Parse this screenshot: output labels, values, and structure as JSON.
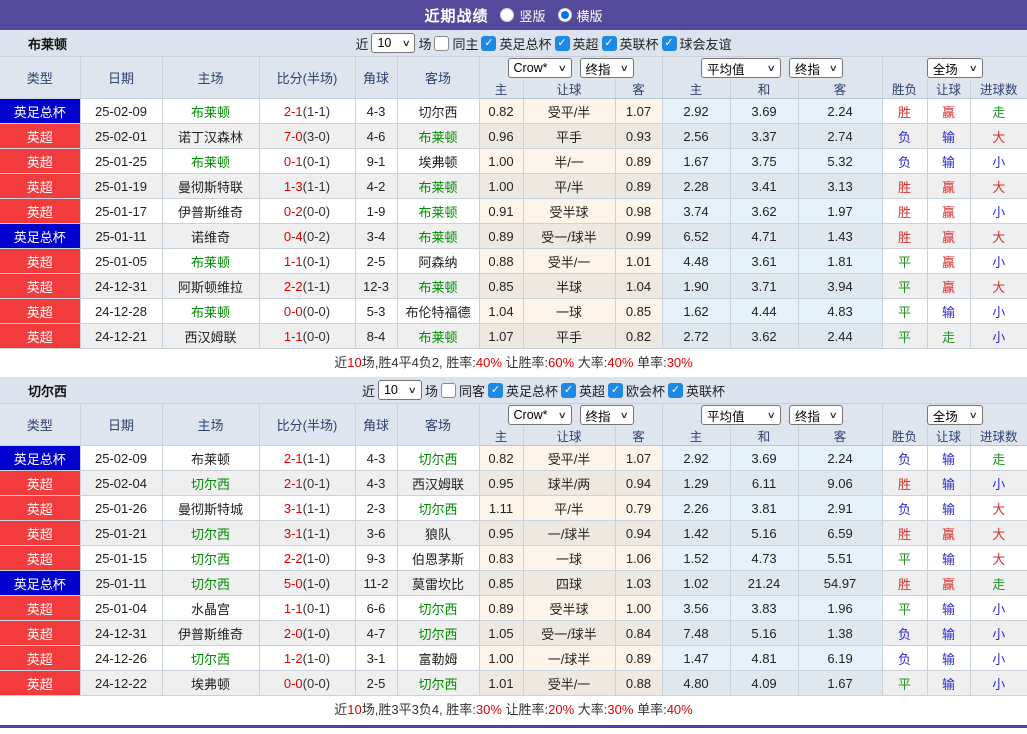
{
  "header": {
    "title": "近期战绩",
    "radios": [
      {
        "label": "竖版",
        "checked": false
      },
      {
        "label": "横版",
        "checked": true
      }
    ]
  },
  "icons": {
    "dropdown": "∨",
    "check": "✓"
  },
  "colors": {
    "titlebar": "#54499B",
    "cup_badge": "#0101CD",
    "league_badge": "#F23B3C",
    "team_green": "#008C00",
    "score_red": "#E10000",
    "result_red": "#D93030",
    "result_blue": "#2A2ACF",
    "result_green": "#1F9426"
  },
  "columns": {
    "main": [
      "类型",
      "日期",
      "主场",
      "比分(半场)",
      "角球",
      "客场"
    ],
    "sub": [
      "主",
      "让球",
      "客",
      "主",
      "和",
      "客",
      "胜负",
      "让球",
      "进球数"
    ],
    "selects": {
      "crow": "Crow*",
      "zhong1": "终指",
      "avg": "平均值",
      "zhong2": "终指",
      "full": "全场"
    }
  },
  "sections": [
    {
      "team": "布莱顿",
      "filter": {
        "prefix": "近",
        "count": "10",
        "suffix": "场",
        "same": "同主",
        "leagues": [
          "英足总杯",
          "英超",
          "英联杯",
          "球会友谊"
        ]
      },
      "rows": [
        {
          "type": "英足总杯",
          "type_c": "cup",
          "date": "25-02-09",
          "home": "布莱顿",
          "home_g": true,
          "score": "2-1",
          "half": "(1-1)",
          "corner": "4-3",
          "away": "切尔西",
          "away_g": false,
          "o1": "0.82",
          "hcap": "受平/半",
          "o2": "1.07",
          "a1": "2.92",
          "a2": "3.69",
          "a3": "2.24",
          "wl": "胜",
          "wl_c": "r",
          "hd": "赢",
          "hd_c": "r",
          "ou": "走",
          "ou_c": "g"
        },
        {
          "type": "英超",
          "type_c": "league",
          "date": "25-02-01",
          "home": "诺丁汉森林",
          "home_g": false,
          "score": "7-0",
          "half": "(3-0)",
          "corner": "4-6",
          "away": "布莱顿",
          "away_g": true,
          "o1": "0.96",
          "hcap": "平手",
          "o2": "0.93",
          "a1": "2.56",
          "a2": "3.37",
          "a3": "2.74",
          "wl": "负",
          "wl_c": "b",
          "hd": "输",
          "hd_c": "b",
          "ou": "大",
          "ou_c": "r"
        },
        {
          "type": "英超",
          "type_c": "league",
          "date": "25-01-25",
          "home": "布莱顿",
          "home_g": true,
          "score": "0-1",
          "half": "(0-1)",
          "corner": "9-1",
          "away": "埃弗顿",
          "away_g": false,
          "o1": "1.00",
          "hcap": "半/一",
          "o2": "0.89",
          "a1": "1.67",
          "a2": "3.75",
          "a3": "5.32",
          "wl": "负",
          "wl_c": "b",
          "hd": "输",
          "hd_c": "b",
          "ou": "小",
          "ou_c": "b"
        },
        {
          "type": "英超",
          "type_c": "league",
          "date": "25-01-19",
          "home": "曼彻斯特联",
          "home_g": false,
          "score": "1-3",
          "half": "(1-1)",
          "corner": "4-2",
          "away": "布莱顿",
          "away_g": true,
          "o1": "1.00",
          "hcap": "平/半",
          "o2": "0.89",
          "a1": "2.28",
          "a2": "3.41",
          "a3": "3.13",
          "wl": "胜",
          "wl_c": "r",
          "hd": "赢",
          "hd_c": "r",
          "ou": "大",
          "ou_c": "r"
        },
        {
          "type": "英超",
          "type_c": "league",
          "date": "25-01-17",
          "home": "伊普斯维奇",
          "home_g": false,
          "score": "0-2",
          "half": "(0-0)",
          "corner": "1-9",
          "away": "布莱顿",
          "away_g": true,
          "o1": "0.91",
          "hcap": "受半球",
          "o2": "0.98",
          "a1": "3.74",
          "a2": "3.62",
          "a3": "1.97",
          "wl": "胜",
          "wl_c": "r",
          "hd": "赢",
          "hd_c": "r",
          "ou": "小",
          "ou_c": "b"
        },
        {
          "type": "英足总杯",
          "type_c": "cup",
          "date": "25-01-11",
          "home": "诺维奇",
          "home_g": false,
          "score": "0-4",
          "half": "(0-2)",
          "corner": "3-4",
          "away": "布莱顿",
          "away_g": true,
          "o1": "0.89",
          "hcap": "受一/球半",
          "o2": "0.99",
          "a1": "6.52",
          "a2": "4.71",
          "a3": "1.43",
          "wl": "胜",
          "wl_c": "r",
          "hd": "赢",
          "hd_c": "r",
          "ou": "大",
          "ou_c": "r"
        },
        {
          "type": "英超",
          "type_c": "league",
          "date": "25-01-05",
          "home": "布莱顿",
          "home_g": true,
          "score": "1-1",
          "half": "(0-1)",
          "corner": "2-5",
          "away": "阿森纳",
          "away_g": false,
          "o1": "0.88",
          "hcap": "受半/一",
          "o2": "1.01",
          "a1": "4.48",
          "a2": "3.61",
          "a3": "1.81",
          "wl": "平",
          "wl_c": "g",
          "hd": "赢",
          "hd_c": "r",
          "ou": "小",
          "ou_c": "b"
        },
        {
          "type": "英超",
          "type_c": "league",
          "date": "24-12-31",
          "home": "阿斯顿维拉",
          "home_g": false,
          "score": "2-2",
          "half": "(1-1)",
          "corner": "12-3",
          "away": "布莱顿",
          "away_g": true,
          "o1": "0.85",
          "hcap": "半球",
          "o2": "1.04",
          "a1": "1.90",
          "a2": "3.71",
          "a3": "3.94",
          "wl": "平",
          "wl_c": "g",
          "hd": "赢",
          "hd_c": "r",
          "ou": "大",
          "ou_c": "r"
        },
        {
          "type": "英超",
          "type_c": "league",
          "date": "24-12-28",
          "home": "布莱顿",
          "home_g": true,
          "score": "0-0",
          "half": "(0-0)",
          "corner": "5-3",
          "away": "布伦特福德",
          "away_g": false,
          "o1": "1.04",
          "hcap": "一球",
          "o2": "0.85",
          "a1": "1.62",
          "a2": "4.44",
          "a3": "4.83",
          "wl": "平",
          "wl_c": "g",
          "hd": "输",
          "hd_c": "b",
          "ou": "小",
          "ou_c": "b"
        },
        {
          "type": "英超",
          "type_c": "league",
          "date": "24-12-21",
          "home": "西汉姆联",
          "home_g": false,
          "score": "1-1",
          "half": "(0-0)",
          "corner": "8-4",
          "away": "布莱顿",
          "away_g": true,
          "o1": "1.07",
          "hcap": "平手",
          "o2": "0.82",
          "a1": "2.72",
          "a2": "3.62",
          "a3": "2.44",
          "wl": "平",
          "wl_c": "g",
          "hd": "走",
          "hd_c": "g",
          "ou": "小",
          "ou_c": "b"
        }
      ],
      "summary": [
        {
          "text": "近",
          "red": false
        },
        {
          "text": "10",
          "red": true
        },
        {
          "text": "场,胜4平4负2, 胜率:",
          "red": false
        },
        {
          "text": "40%",
          "red": true
        },
        {
          "text": " 让胜率:",
          "red": false
        },
        {
          "text": "60%",
          "red": true
        },
        {
          "text": " 大率:",
          "red": false
        },
        {
          "text": "40%",
          "red": true
        },
        {
          "text": " 单率:",
          "red": false
        },
        {
          "text": "30%",
          "red": true
        }
      ]
    },
    {
      "team": "切尔西",
      "filter": {
        "prefix": "近",
        "count": "10",
        "suffix": "场",
        "same": "同客",
        "leagues": [
          "英足总杯",
          "英超",
          "欧会杯",
          "英联杯"
        ]
      },
      "rows": [
        {
          "type": "英足总杯",
          "type_c": "cup",
          "date": "25-02-09",
          "home": "布莱顿",
          "home_g": false,
          "score": "2-1",
          "half": "(1-1)",
          "corner": "4-3",
          "away": "切尔西",
          "away_g": true,
          "o1": "0.82",
          "hcap": "受平/半",
          "o2": "1.07",
          "a1": "2.92",
          "a2": "3.69",
          "a3": "2.24",
          "wl": "负",
          "wl_c": "b",
          "hd": "输",
          "hd_c": "b",
          "ou": "走",
          "ou_c": "g"
        },
        {
          "type": "英超",
          "type_c": "league",
          "date": "25-02-04",
          "home": "切尔西",
          "home_g": true,
          "score": "2-1",
          "half": "(0-1)",
          "corner": "4-3",
          "away": "西汉姆联",
          "away_g": false,
          "o1": "0.95",
          "hcap": "球半/两",
          "o2": "0.94",
          "a1": "1.29",
          "a2": "6.11",
          "a3": "9.06",
          "wl": "胜",
          "wl_c": "r",
          "hd": "输",
          "hd_c": "b",
          "ou": "小",
          "ou_c": "b"
        },
        {
          "type": "英超",
          "type_c": "league",
          "date": "25-01-26",
          "home": "曼彻斯特城",
          "home_g": false,
          "score": "3-1",
          "half": "(1-1)",
          "corner": "2-3",
          "away": "切尔西",
          "away_g": true,
          "o1": "1.11",
          "hcap": "平/半",
          "o2": "0.79",
          "a1": "2.26",
          "a2": "3.81",
          "a3": "2.91",
          "wl": "负",
          "wl_c": "b",
          "hd": "输",
          "hd_c": "b",
          "ou": "大",
          "ou_c": "r"
        },
        {
          "type": "英超",
          "type_c": "league",
          "date": "25-01-21",
          "home": "切尔西",
          "home_g": true,
          "score": "3-1",
          "half": "(1-1)",
          "corner": "3-6",
          "away": "狼队",
          "away_g": false,
          "o1": "0.95",
          "hcap": "一/球半",
          "o2": "0.94",
          "a1": "1.42",
          "a2": "5.16",
          "a3": "6.59",
          "wl": "胜",
          "wl_c": "r",
          "hd": "赢",
          "hd_c": "r",
          "ou": "大",
          "ou_c": "r"
        },
        {
          "type": "英超",
          "type_c": "league",
          "date": "25-01-15",
          "home": "切尔西",
          "home_g": true,
          "score": "2-2",
          "half": "(1-0)",
          "corner": "9-3",
          "away": "伯恩茅斯",
          "away_g": false,
          "o1": "0.83",
          "hcap": "一球",
          "o2": "1.06",
          "a1": "1.52",
          "a2": "4.73",
          "a3": "5.51",
          "wl": "平",
          "wl_c": "g",
          "hd": "输",
          "hd_c": "b",
          "ou": "大",
          "ou_c": "r"
        },
        {
          "type": "英足总杯",
          "type_c": "cup",
          "date": "25-01-11",
          "home": "切尔西",
          "home_g": true,
          "score": "5-0",
          "half": "(1-0)",
          "corner": "11-2",
          "away": "莫雷坎比",
          "away_g": false,
          "o1": "0.85",
          "hcap": "四球",
          "o2": "1.03",
          "a1": "1.02",
          "a2": "21.24",
          "a3": "54.97",
          "wl": "胜",
          "wl_c": "r",
          "hd": "赢",
          "hd_c": "r",
          "ou": "走",
          "ou_c": "g"
        },
        {
          "type": "英超",
          "type_c": "league",
          "date": "25-01-04",
          "home": "水晶宫",
          "home_g": false,
          "score": "1-1",
          "half": "(0-1)",
          "corner": "6-6",
          "away": "切尔西",
          "away_g": true,
          "o1": "0.89",
          "hcap": "受半球",
          "o2": "1.00",
          "a1": "3.56",
          "a2": "3.83",
          "a3": "1.96",
          "wl": "平",
          "wl_c": "g",
          "hd": "输",
          "hd_c": "b",
          "ou": "小",
          "ou_c": "b"
        },
        {
          "type": "英超",
          "type_c": "league",
          "date": "24-12-31",
          "home": "伊普斯维奇",
          "home_g": false,
          "score": "2-0",
          "half": "(1-0)",
          "corner": "4-7",
          "away": "切尔西",
          "away_g": true,
          "o1": "1.05",
          "hcap": "受一/球半",
          "o2": "0.84",
          "a1": "7.48",
          "a2": "5.16",
          "a3": "1.38",
          "wl": "负",
          "wl_c": "b",
          "hd": "输",
          "hd_c": "b",
          "ou": "小",
          "ou_c": "b"
        },
        {
          "type": "英超",
          "type_c": "league",
          "date": "24-12-26",
          "home": "切尔西",
          "home_g": true,
          "score": "1-2",
          "half": "(1-0)",
          "corner": "3-1",
          "away": "富勒姆",
          "away_g": false,
          "o1": "1.00",
          "hcap": "一/球半",
          "o2": "0.89",
          "a1": "1.47",
          "a2": "4.81",
          "a3": "6.19",
          "wl": "负",
          "wl_c": "b",
          "hd": "输",
          "hd_c": "b",
          "ou": "小",
          "ou_c": "b"
        },
        {
          "type": "英超",
          "type_c": "league",
          "date": "24-12-22",
          "home": "埃弗顿",
          "home_g": false,
          "score": "0-0",
          "half": "(0-0)",
          "corner": "2-5",
          "away": "切尔西",
          "away_g": true,
          "o1": "1.01",
          "hcap": "受半/一",
          "o2": "0.88",
          "a1": "4.80",
          "a2": "4.09",
          "a3": "1.67",
          "wl": "平",
          "wl_c": "g",
          "hd": "输",
          "hd_c": "b",
          "ou": "小",
          "ou_c": "b"
        }
      ],
      "summary": [
        {
          "text": "近",
          "red": false
        },
        {
          "text": "10",
          "red": true
        },
        {
          "text": "场,胜3平3负4, 胜率:",
          "red": false
        },
        {
          "text": "30%",
          "red": true
        },
        {
          "text": " 让胜率:",
          "red": false
        },
        {
          "text": "20%",
          "red": true
        },
        {
          "text": " 大率:",
          "red": false
        },
        {
          "text": "30%",
          "red": true
        },
        {
          "text": " 单率:",
          "red": false
        },
        {
          "text": "40%",
          "red": true
        }
      ]
    }
  ]
}
